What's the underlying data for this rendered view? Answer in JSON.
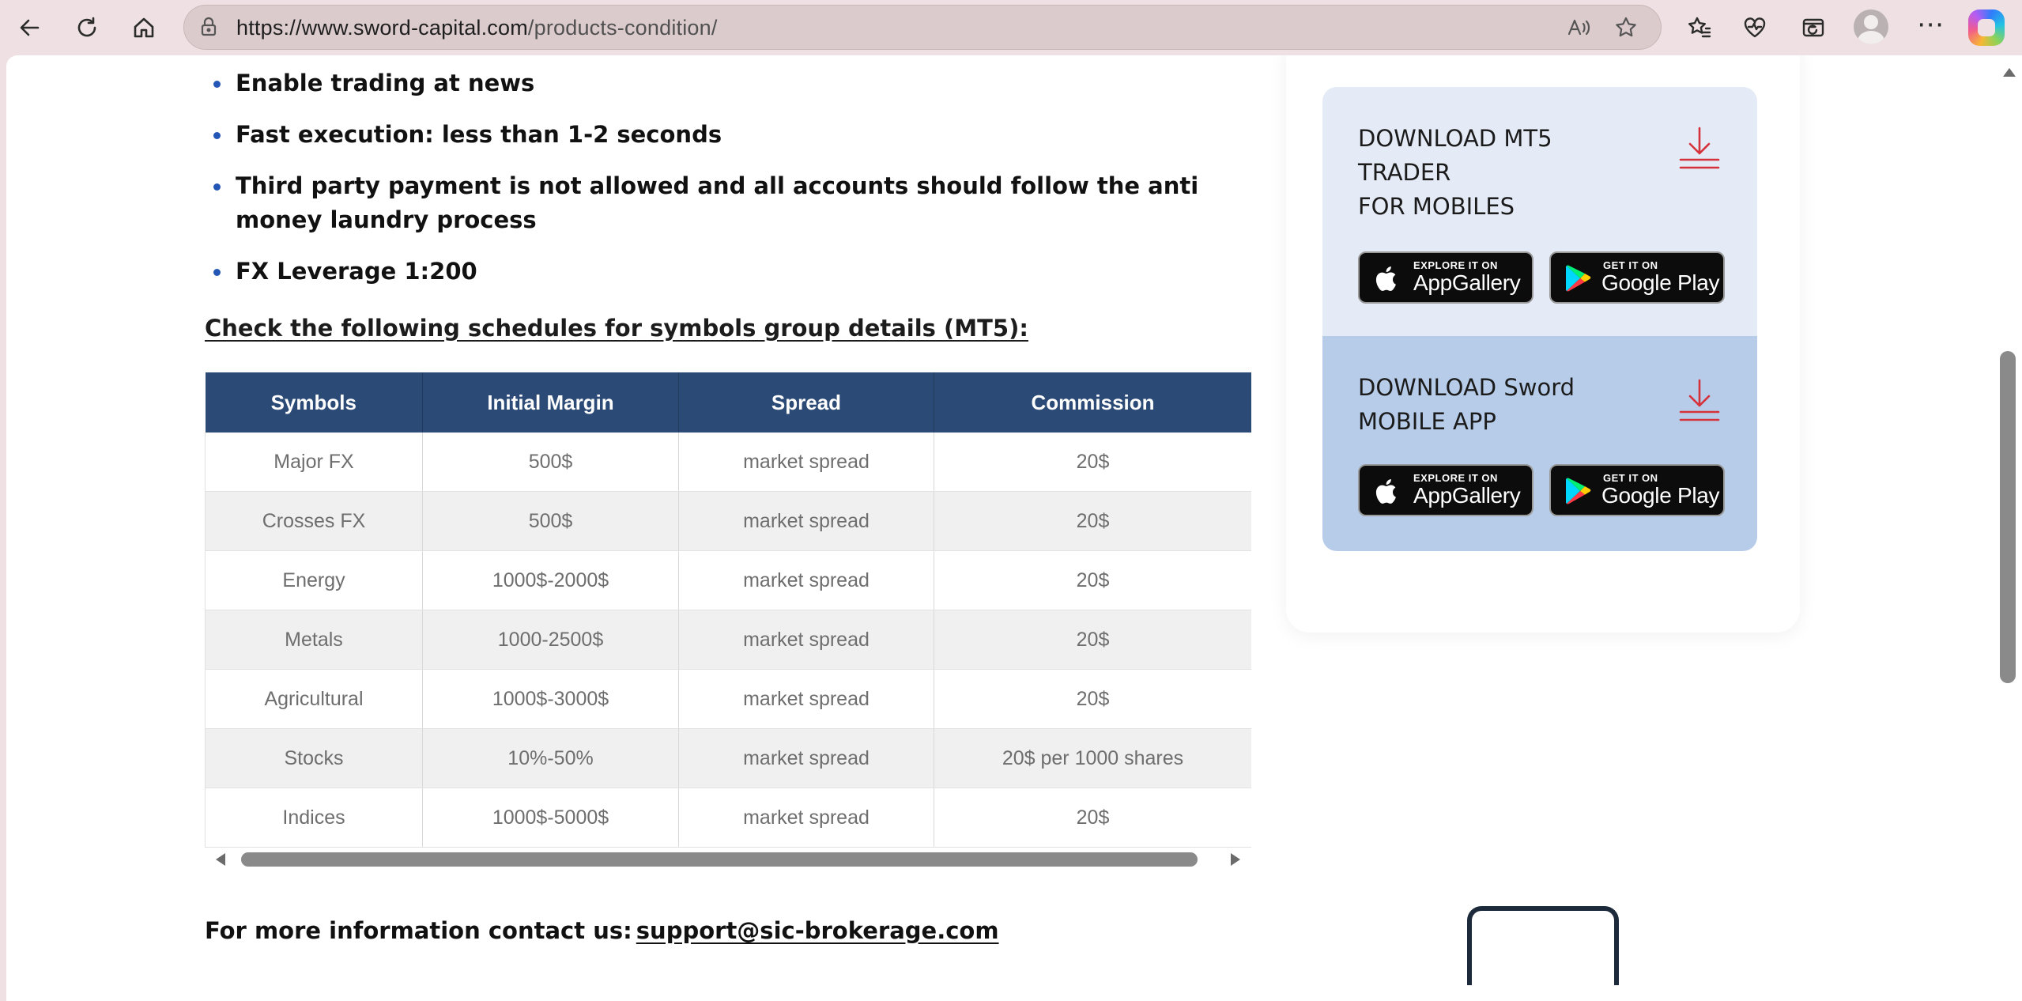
{
  "browser": {
    "url_host": "https://www.sword-capital.com",
    "url_path": "/products-condition/"
  },
  "conditions": [
    "Enable trading at news",
    "Fast execution: less than 1-2 seconds",
    "Third party payment is not allowed and all accounts should follow the anti money laundry process",
    "FX Leverage 1:200"
  ],
  "schedules_heading": "Check the following schedules for symbols group details (MT5):",
  "table": {
    "headers": [
      "Symbols",
      "Initial Margin",
      "Spread",
      "Commission"
    ],
    "rows": [
      [
        "Major FX",
        "500$",
        "market spread",
        "20$"
      ],
      [
        "Crosses FX",
        "500$",
        "market spread",
        "20$"
      ],
      [
        "Energy",
        "1000$-2000$",
        "market spread",
        "20$"
      ],
      [
        "Metals",
        "1000-2500$",
        "market spread",
        "20$"
      ],
      [
        "Agricultural",
        "1000$-3000$",
        "market spread",
        "20$"
      ],
      [
        "Stocks",
        "10%-50%",
        "market spread",
        "20$ per 1000 shares"
      ],
      [
        "Indices",
        "1000$-5000$",
        "market spread",
        "20$"
      ]
    ]
  },
  "contact": {
    "label": "For more information contact us:",
    "email": "support@sic-brokerage.com"
  },
  "downloads": [
    {
      "title_lines": [
        "DOWNLOAD MT5",
        "TRADER",
        "FOR MOBILES"
      ],
      "appgallery_small": "EXPLORE IT ON",
      "appgallery_big": "AppGallery",
      "googleplay_small": "GET IT ON",
      "googleplay_big": "Google Play"
    },
    {
      "title_lines": [
        "DOWNLOAD Sword",
        "MOBILE APP"
      ],
      "appgallery_small": "EXPLORE IT ON",
      "appgallery_big": "AppGallery",
      "googleplay_small": "GET IT ON",
      "googleplay_big": "Google Play"
    }
  ],
  "colors": {
    "table_header": "#2c4a76",
    "card_light": "#e4ebf6",
    "card_blue": "#b6cce9",
    "download_icon": "#d6323b",
    "bullet": "#2457b5"
  },
  "icons": [
    "back-icon",
    "refresh-icon",
    "home-icon",
    "lock-icon",
    "read-aloud-icon",
    "favorite-star-icon",
    "favorites-icon",
    "health-icon",
    "ie-mode-icon",
    "profile-icon",
    "more-icon",
    "copilot-icon",
    "download-icon",
    "apple-icon",
    "google-play-icon"
  ]
}
